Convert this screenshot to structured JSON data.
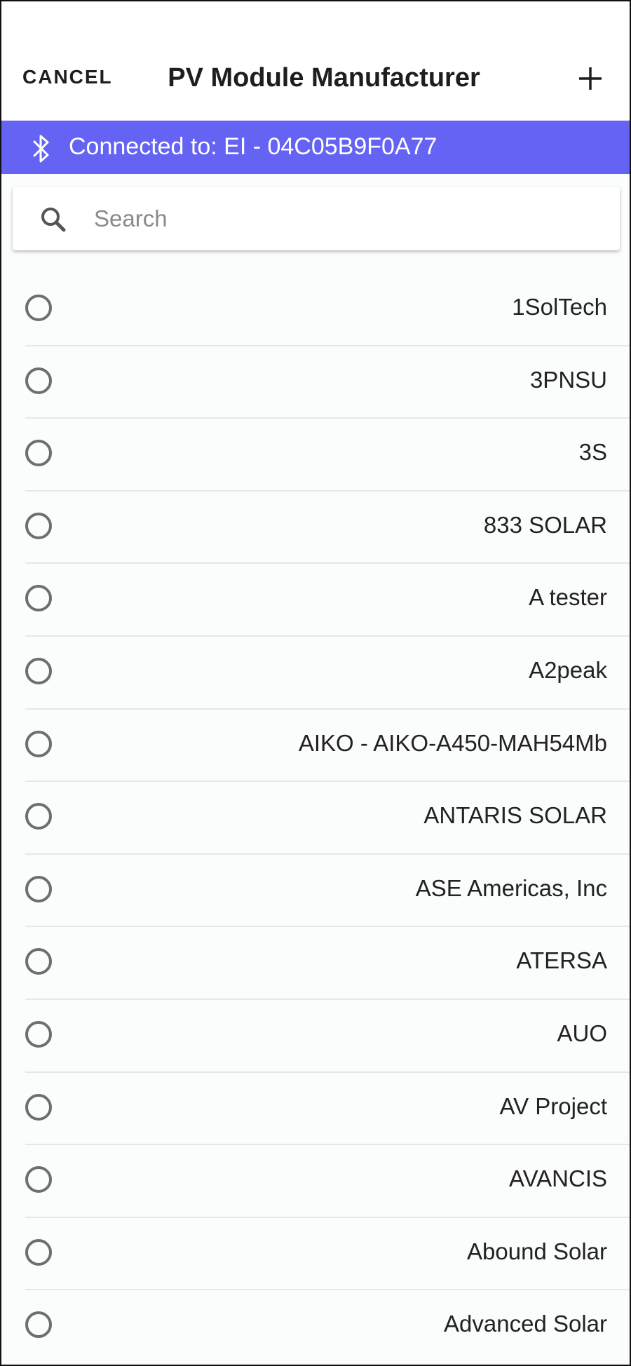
{
  "header": {
    "cancel_label": "CANCEL",
    "title": "PV Module Manufacturer",
    "add_icon": "plus-icon"
  },
  "connection": {
    "icon": "bluetooth-icon",
    "text": "Connected to: EI - 04C05B9F0A77",
    "color": "#6563f3"
  },
  "search": {
    "icon": "search-icon",
    "placeholder": "Search",
    "value": ""
  },
  "manufacturers": [
    {
      "label": "1SolTech",
      "selected": false
    },
    {
      "label": "3PNSU",
      "selected": false
    },
    {
      "label": "3S",
      "selected": false
    },
    {
      "label": "833 SOLAR",
      "selected": false
    },
    {
      "label": "A tester",
      "selected": false
    },
    {
      "label": "A2peak",
      "selected": false
    },
    {
      "label": "AIKO - AIKO-A450-MAH54Mb",
      "selected": false
    },
    {
      "label": "ANTARIS SOLAR",
      "selected": false
    },
    {
      "label": "ASE Americas, Inc",
      "selected": false
    },
    {
      "label": "ATERSA",
      "selected": false
    },
    {
      "label": "AUO",
      "selected": false
    },
    {
      "label": "AV Project",
      "selected": false
    },
    {
      "label": "AVANCIS",
      "selected": false
    },
    {
      "label": "Abound Solar",
      "selected": false
    },
    {
      "label": "Advanced Solar",
      "selected": false
    }
  ]
}
